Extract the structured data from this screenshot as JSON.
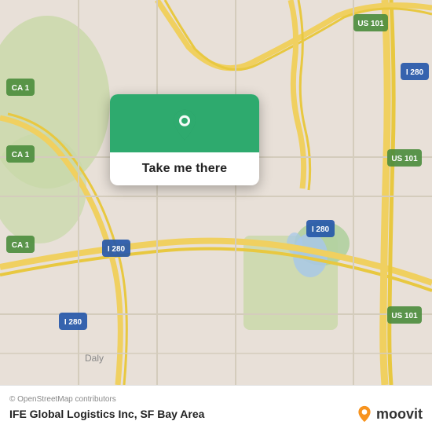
{
  "map": {
    "attribution": "© OpenStreetMap contributors",
    "background_color": "#e8e0d8"
  },
  "popup": {
    "button_label": "Take me there",
    "icon_alt": "location pin"
  },
  "footer": {
    "title": "IFE Global Logistics Inc, SF Bay Area",
    "attribution": "© OpenStreetMap contributors",
    "moovit_label": "moovit"
  }
}
